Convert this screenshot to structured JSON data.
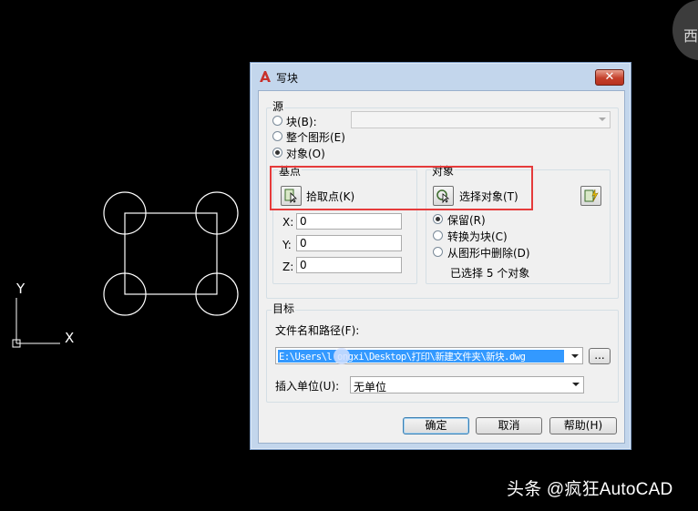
{
  "cad": {
    "ucs_x_label": "X",
    "ucs_y_label": "Y",
    "corner_button_text": "西",
    "watermark": "头条 @疯狂AutoCAD"
  },
  "dialog": {
    "title": "写块",
    "close_label": "✕",
    "source": {
      "title": "源",
      "options": [
        {
          "label": "块(B):",
          "checked": false
        },
        {
          "label": "整个图形(E)",
          "checked": false
        },
        {
          "label": "对象(O)",
          "checked": true
        }
      ],
      "block_combo_value": ""
    },
    "basepoint": {
      "title": "基点",
      "pick_label": "拾取点(K)",
      "x_label": "X:",
      "y_label": "Y:",
      "z_label": "Z:",
      "x_value": "0",
      "y_value": "0",
      "z_value": "0"
    },
    "objects": {
      "title": "对象",
      "select_label": "选择对象(T)",
      "options": [
        {
          "label": "保留(R)",
          "checked": true
        },
        {
          "label": "转换为块(C)",
          "checked": false
        },
        {
          "label": "从图形中删除(D)",
          "checked": false
        }
      ],
      "status": "已选择 5 个对象"
    },
    "destination": {
      "title": "目标",
      "filename_label": "文件名和路径(F):",
      "filename_value": "E:\\Users\\l    ongxi\\Desktop\\打印\\新建文件夹\\新块.dwg",
      "browse_label": "...",
      "units_label": "插入单位(U):",
      "units_value": "无单位"
    },
    "buttons": {
      "ok": "确定",
      "cancel": "取消",
      "help": "帮助(H)"
    }
  },
  "colors": {
    "highlight": "#e53b3b",
    "selection": "#3399ff",
    "dialog_frame": "#c3d6ec"
  }
}
